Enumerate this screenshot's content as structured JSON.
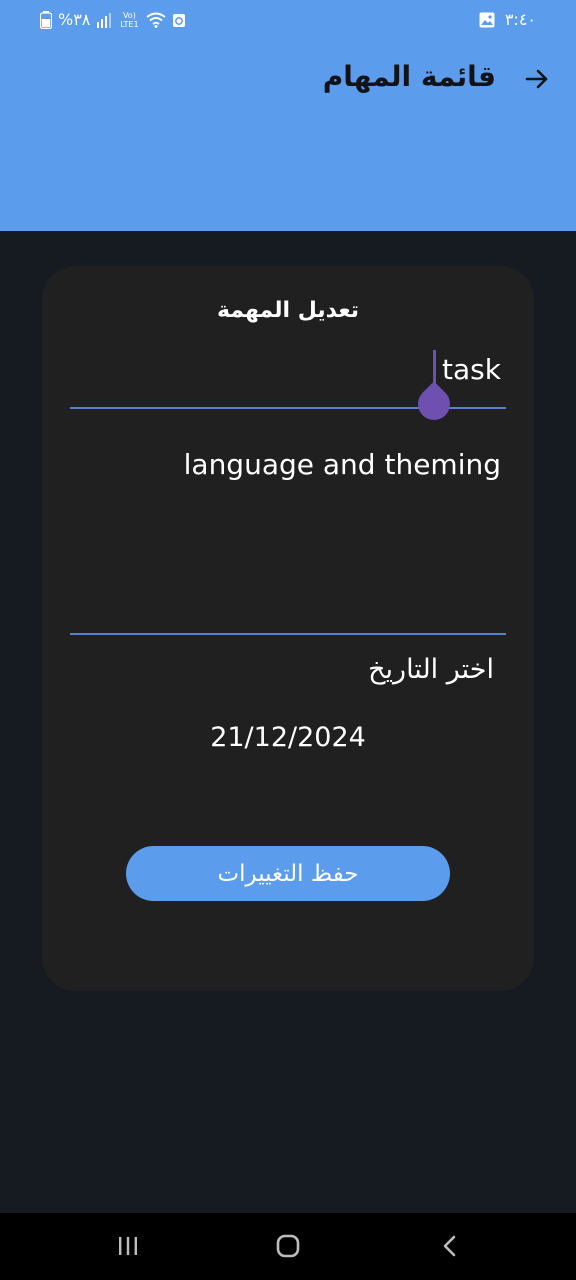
{
  "status_bar": {
    "time": "٣:٤٠",
    "battery": "%٣٨",
    "network": "Vo) LTE1",
    "icons": [
      "battery-icon",
      "signal-icon",
      "wifi-icon",
      "recycle-icon",
      "gallery-icon"
    ]
  },
  "app_bar": {
    "title": "قائمة المهام",
    "back_icon": "arrow-right-icon",
    "color": "#5b9cec"
  },
  "card": {
    "title": "تعديل المهمة",
    "title_field_value": "task",
    "description_field_value": "language and theming",
    "date_label": "اختر التاريخ",
    "date_value": "21/12/2024",
    "save_label": "حفظ التغييرات"
  },
  "nav_bar": {
    "icons": [
      "recents-icon",
      "home-icon",
      "back-chevron-icon"
    ]
  },
  "colors": {
    "background": "#161b22",
    "card": "#202020",
    "accent": "#5b9cec",
    "cursor": "#6f4fb0"
  }
}
